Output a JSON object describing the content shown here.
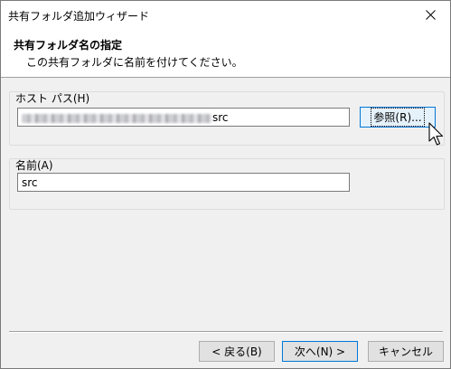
{
  "window": {
    "title": "共有フォルダ追加ウィザード"
  },
  "header": {
    "title": "共有フォルダ名の指定",
    "description": "この共有フォルダに名前を付けてください。"
  },
  "host_path": {
    "label": "ホスト パス(H)",
    "value_suffix": "src",
    "browse_label": "参照(R)..."
  },
  "name": {
    "label": "名前(A)",
    "value": "src"
  },
  "footer": {
    "back_label": "< 戻る(B)",
    "next_label": "次へ(N) >",
    "cancel_label": "キャンセル"
  },
  "icons": [
    "close-icon",
    "mouse-cursor-icon"
  ]
}
